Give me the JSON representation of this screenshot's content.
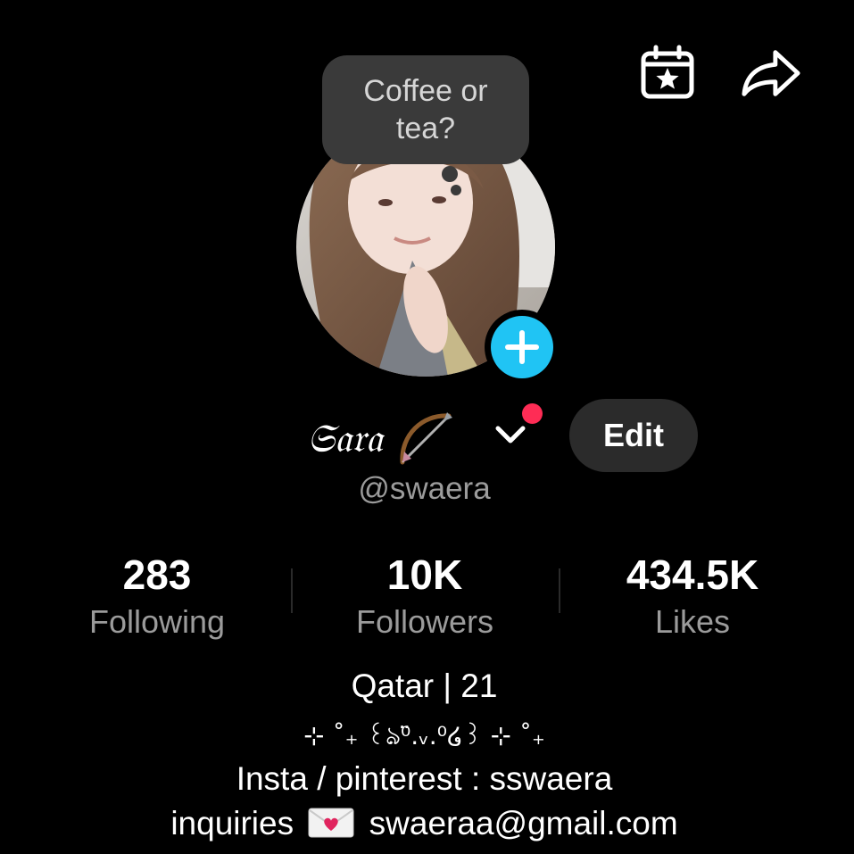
{
  "header": {
    "calendar_icon": "calendar-star-icon",
    "share_icon": "share-arrow-icon"
  },
  "note": {
    "text": "Coffee or tea?"
  },
  "profile": {
    "display_name": "𝔖𝔞𝔯𝔞",
    "name_emoji": "bow-and-arrow-icon",
    "username": "@swaera",
    "edit_label": "Edit"
  },
  "stats": {
    "following": {
      "value": "283",
      "label": "Following"
    },
    "followers": {
      "value": "10K",
      "label": "Followers"
    },
    "likes": {
      "value": "434.5K",
      "label": "Likes"
    }
  },
  "bio": {
    "line1": "Qatar | 21",
    "line2": "⊹ ˚₊ ꒰ঌ⁰̈.ᵥ.⁰໒꒱ ⊹ ˚₊",
    "line3": "Insta / pinterest : sswaera",
    "line4_prefix": "inquiries",
    "line4_email": "swaeraa@gmail.com"
  },
  "colors": {
    "background": "#000000",
    "accent_blue": "#20c4f4",
    "notification_red": "#fe2c55",
    "secondary_text": "#9b9b9b",
    "button_bg": "#2b2b2b"
  }
}
